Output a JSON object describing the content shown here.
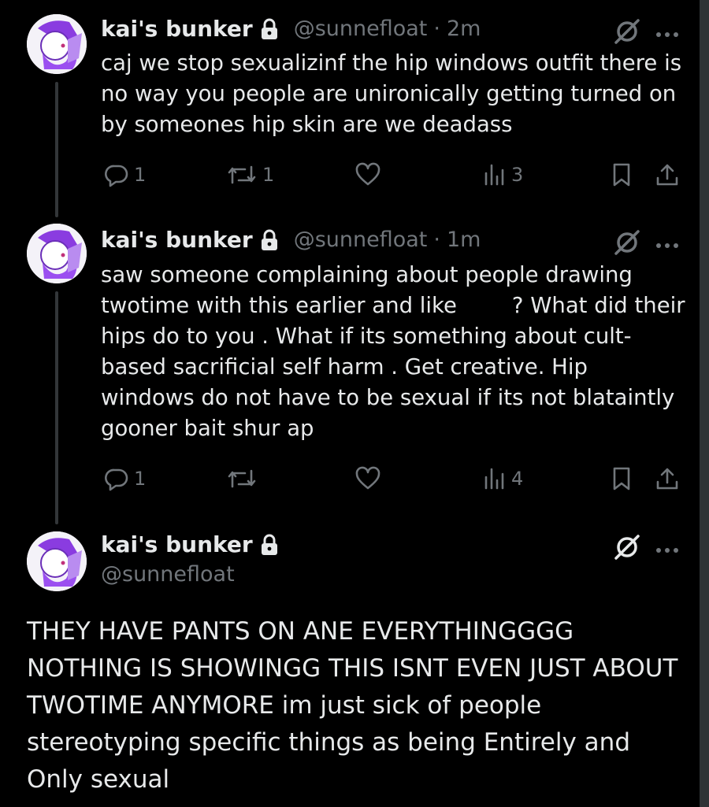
{
  "tweets": [
    {
      "name": "kai's bunker",
      "handle": "@sunnefloat",
      "separator": "·",
      "time": "2m",
      "text": "caj we stop sexualizinf the hip windows outfit there is no way you people are unironically getting turned on by someones hip skin are we deadass",
      "replies": "1",
      "reposts": "1",
      "likes": "",
      "views": "3"
    },
    {
      "name": "kai's bunker",
      "handle": "@sunnefloat",
      "separator": "·",
      "time": "1m",
      "text": "saw someone complaining about people drawing twotime with this earlier and like        ? What did their hips do to you . What if its something about cult-based sacrificial self harm . Get creative. Hip windows do not have to be sexual if its not blataintly gooner bait shur ap",
      "replies": "1",
      "reposts": "",
      "likes": "",
      "views": "4"
    }
  ],
  "main_tweet": {
    "name": "kai's bunker",
    "handle": "@sunnefloat",
    "text": "THEY HAVE PANTS ON ANE EVERYTHINGGGG NOTHING IS SHOWINGG THIS ISNT EVEN JUST ABOUT TWOTIME ANYMORE im just sick of people stereotyping specific things as being Entirely and Only sexual"
  },
  "icons": {
    "reply": "reply-icon",
    "repost": "repost-icon",
    "like": "heart-icon",
    "views": "views-icon",
    "bookmark": "bookmark-icon",
    "share": "share-icon",
    "lock": "lock-icon",
    "grok": "grok-icon",
    "more": "more-icon"
  },
  "colors": {
    "background": "#000000",
    "text": "#e7e9ea",
    "muted": "#71767b",
    "thread_line": "#333639"
  }
}
